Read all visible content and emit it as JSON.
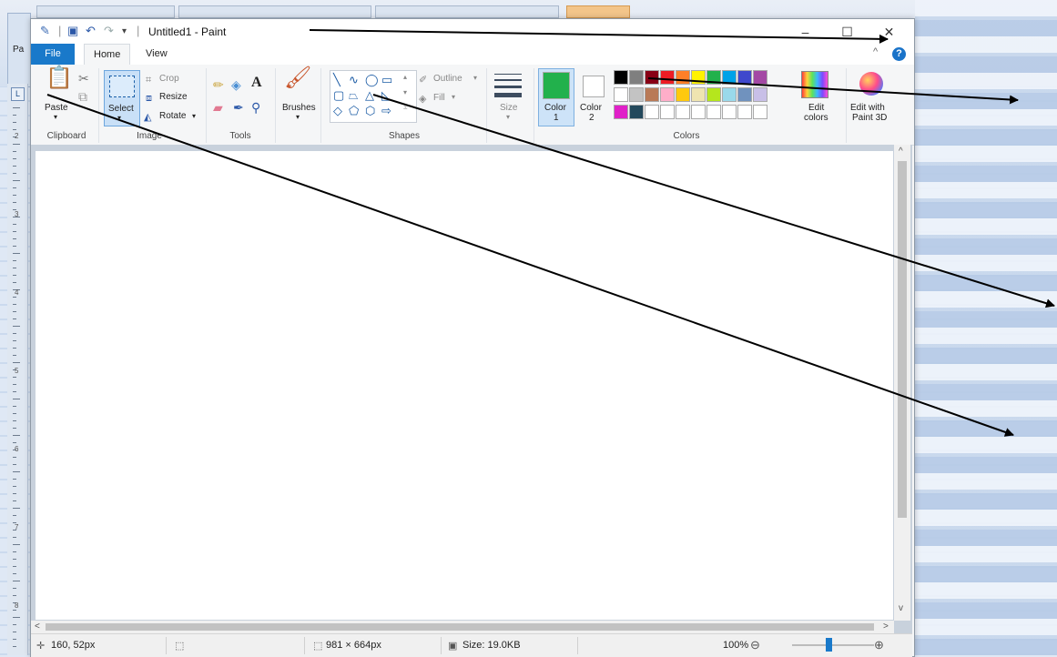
{
  "window": {
    "title": "Untitled1 - Paint",
    "minimize_glyph": "–",
    "maximize_glyph": "☐",
    "close_glyph": "✕"
  },
  "background_app": {
    "paste_label": "Pa"
  },
  "tabs": {
    "file": "File",
    "home": "Home",
    "view": "View"
  },
  "help": {
    "glyph": "?"
  },
  "ribbon": {
    "clipboard": {
      "group": "Clipboard",
      "paste": "Paste"
    },
    "image": {
      "group": "Image",
      "select": "Select",
      "crop": "Crop",
      "resize": "Resize",
      "rotate": "Rotate"
    },
    "tools": {
      "group": "Tools"
    },
    "brushes": {
      "label": "Brushes"
    },
    "shapes": {
      "group": "Shapes",
      "outline": "Outline",
      "fill": "Fill"
    },
    "size": {
      "label": "Size"
    },
    "colors": {
      "group": "Colors",
      "color1_label": "Color",
      "color1_num": "1",
      "color2_label": "Color",
      "color2_num": "2",
      "edit_colors_1": "Edit",
      "edit_colors_2": "colors",
      "edit_paint3d_1": "Edit with",
      "edit_paint3d_2": "Paint 3D",
      "color1_value": "#22b14c",
      "color2_value": "#ffffff",
      "palette_row1": [
        "#000000",
        "#7f7f7f",
        "#880015",
        "#ed1c24",
        "#ff7f27",
        "#fff200",
        "#22b14c",
        "#00a2e8",
        "#3f48cc",
        "#a349a4"
      ],
      "palette_row2": [
        "#ffffff",
        "#c3c3c3",
        "#b97a57",
        "#ffaec9",
        "#ffc90e",
        "#efe4b0",
        "#b5e61d",
        "#99d9ea",
        "#7092be",
        "#c8bfe7"
      ],
      "palette_row3": [
        "#e020c8",
        "#24495c",
        "#ffffff",
        "#ffffff",
        "#ffffff",
        "#ffffff",
        "#ffffff",
        "#ffffff",
        "#ffffff",
        "#ffffff"
      ]
    }
  },
  "status": {
    "cursor": "160, 52px",
    "canvas_size": "981 × 664px",
    "file_size": "Size: 19.0KB",
    "zoom": "100%"
  },
  "ruler_marks": [
    "2",
    "3",
    "4",
    "5",
    "6",
    "7",
    "8"
  ]
}
